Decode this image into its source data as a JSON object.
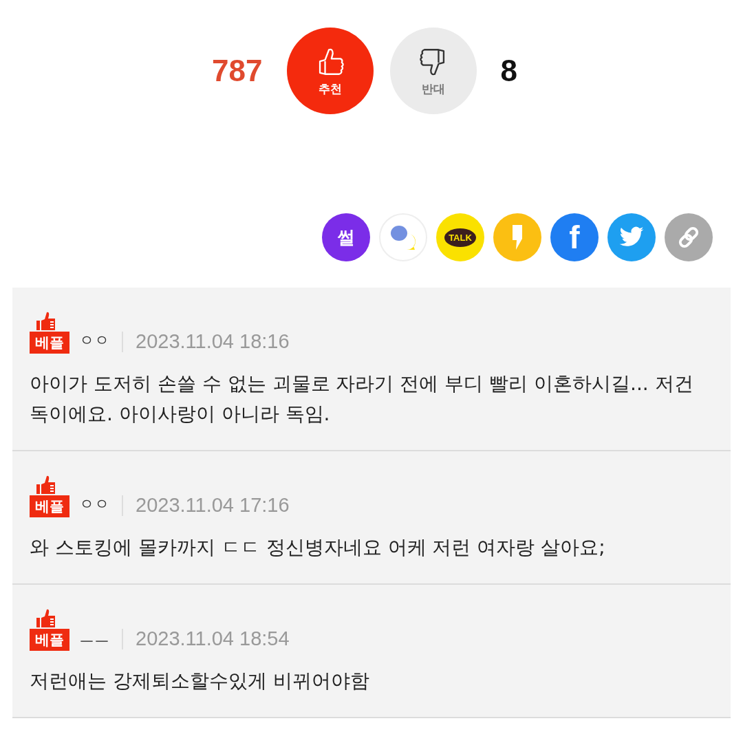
{
  "votes": [
    {
      "kind": "up",
      "count": "787",
      "label": "추천"
    },
    {
      "kind": "down",
      "count": "8",
      "label": "반대"
    }
  ],
  "share": [
    {
      "kind": "sseol",
      "label": "썰"
    },
    {
      "kind": "chat"
    },
    {
      "kind": "talk",
      "label": "TALK"
    },
    {
      "kind": "story"
    },
    {
      "kind": "facebook",
      "label": "f"
    },
    {
      "kind": "twitter"
    },
    {
      "kind": "link"
    }
  ],
  "comments": [
    {
      "badge": "베플",
      "user": "ㅇㅇ",
      "date": "2023.11.04 18:16",
      "text": "아이가 도저히 손쓸 수 없는 괴물로 자라기 전에 부디 빨리 이혼하시길... 저건 독이에요. 아이사랑이 아니라 독임."
    },
    {
      "badge": "베플",
      "user": "ㅇㅇ",
      "date": "2023.11.04 17:16",
      "text": "와 스토킹에 몰카까지 ㄷㄷ 정신병자네요 어케 저런 여자랑 살아요;"
    },
    {
      "badge": "베플",
      "user": "ㅡㅡ",
      "date": "2023.11.04 18:54",
      "text": "저런애는 강제퇴소할수있게 비뀌어야함"
    }
  ]
}
